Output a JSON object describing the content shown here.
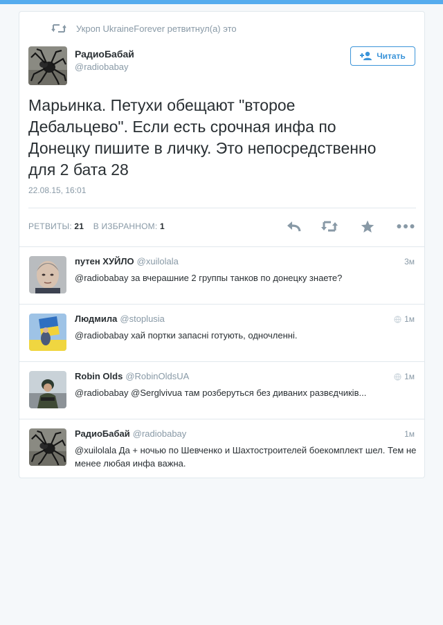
{
  "retweet_context": "Укроп UkraineForever ретвитнул(а) это",
  "author": {
    "name": "РадиоБабай",
    "handle": "@radiobabay"
  },
  "follow_button": {
    "label": "Читать"
  },
  "tweet": {
    "text_lines": [
      "Марьинка. Петухи  обещают \"второе",
      "Дебальцево\". Если есть срочная инфа по",
      "Донецку пишите в личку. Это непосредственно",
      "для 2 бата 28"
    ],
    "timestamp": "22.08.15, 16:01"
  },
  "stats": {
    "retweets_label": "РЕТВИТЫ:",
    "retweets_count": "21",
    "favorites_label": "В ИЗБРАННОМ:",
    "favorites_count": "1"
  },
  "actions": [
    "reply-icon",
    "retweet-icon",
    "favorite-icon",
    "more-icon"
  ],
  "replies": [
    {
      "name": "путен ХУЙЛО",
      "handle": "@xuilolala",
      "time": "3м",
      "globe": false,
      "text": "@radiobabay за вчерашние 2 группы танков по донецку знаете?"
    },
    {
      "name": "Людмила",
      "handle": "@stoplusia",
      "time": "1м",
      "globe": true,
      "text": "@radiobabay хай портки запасні готують, одночленні."
    },
    {
      "name": "Robin Olds",
      "handle": "@RobinOldsUA",
      "time": "1м",
      "globe": true,
      "text": "@radiobabay @Serglvivua там розберуться без диваних развєдчиків..."
    },
    {
      "name": "РадиоБабай",
      "handle": "@radiobabay",
      "time": "1м",
      "globe": false,
      "text": "@xuilolala Да + ночью по Шевченко и Шахтостроителей боекомплект шел. Тем не менее любая инфа важна."
    }
  ],
  "colors": {
    "accent": "#3b94d9",
    "topbar": "#55acee",
    "muted": "#8899a6"
  }
}
